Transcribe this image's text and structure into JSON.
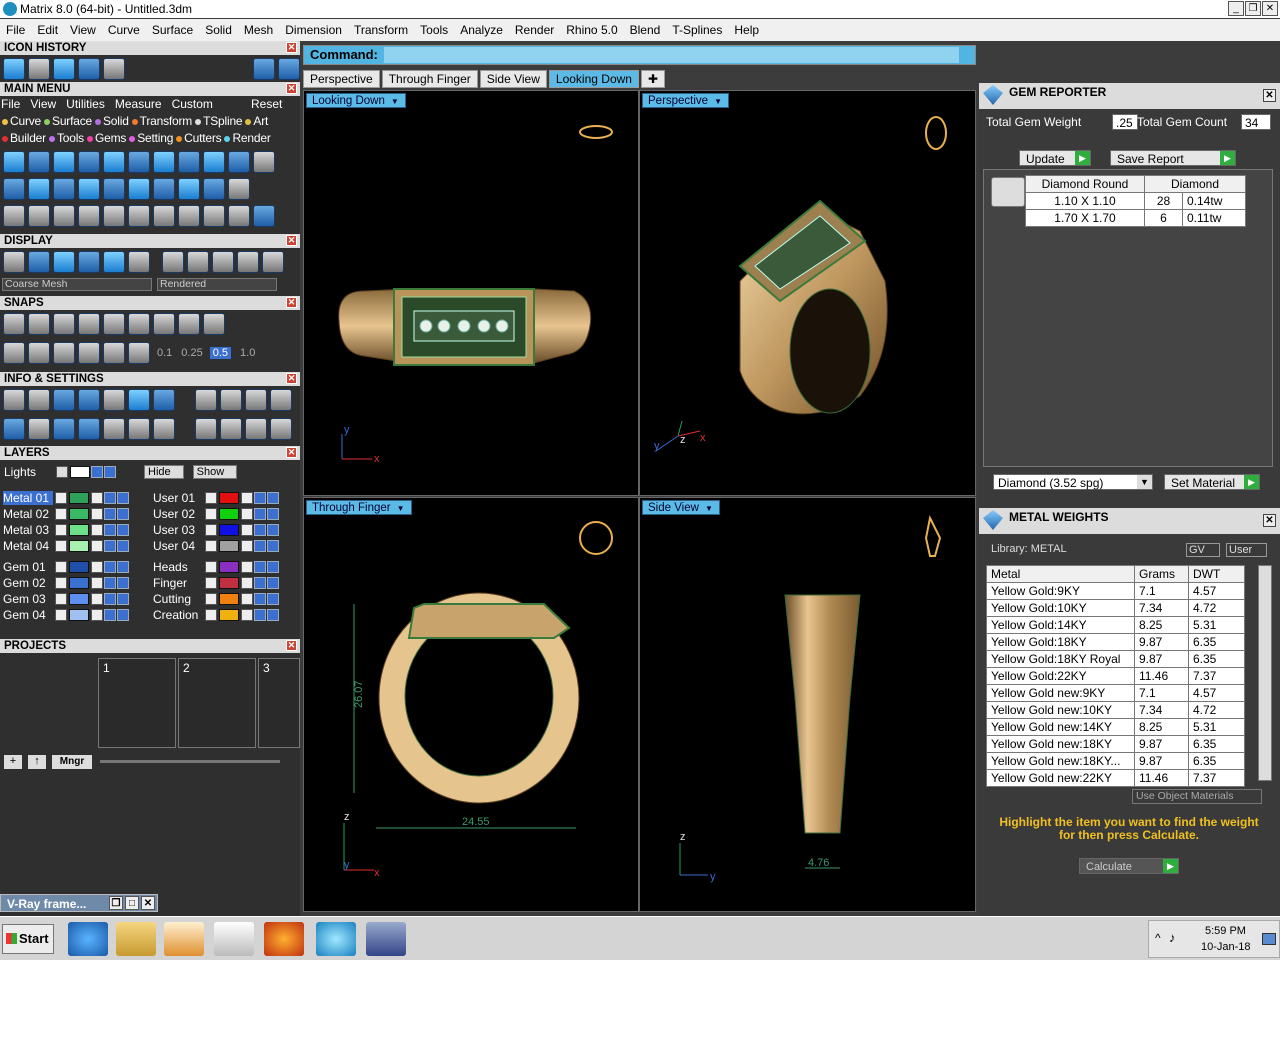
{
  "window": {
    "title": "Matrix 8.0 (64-bit) - Untitled.3dm",
    "controls": [
      "_",
      "❐",
      "✕"
    ]
  },
  "menubar": [
    "File",
    "Edit",
    "View",
    "Curve",
    "Surface",
    "Solid",
    "Mesh",
    "Dimension",
    "Transform",
    "Tools",
    "Analyze",
    "Render",
    "Rhino 5.0",
    "Blend",
    "T-Splines",
    "Help"
  ],
  "left": {
    "icon_history": "ICON HISTORY",
    "main_menu": "MAIN MENU",
    "main_menu_items": [
      "File",
      "View",
      "Utilities",
      "Measure",
      "Custom"
    ],
    "reset": "Reset",
    "categories_row1": [
      {
        "label": "Curve",
        "color": "#f0c040"
      },
      {
        "label": "Surface",
        "color": "#8fd05a"
      },
      {
        "label": "Solid",
        "color": "#b070e0"
      },
      {
        "label": "Transform",
        "color": "#f07a30"
      },
      {
        "label": "TSpline",
        "color": "#e0e0e0"
      },
      {
        "label": "Art",
        "color": "#e0c040"
      }
    ],
    "categories_row2": [
      {
        "label": "Builder",
        "color": "#e03030"
      },
      {
        "label": "Tools",
        "color": "#c070f0"
      },
      {
        "label": "Gems",
        "color": "#f040a0"
      },
      {
        "label": "Setting",
        "color": "#e060e0"
      },
      {
        "label": "Cutters",
        "color": "#f09020"
      },
      {
        "label": "Render",
        "color": "#60d0f0"
      }
    ],
    "display": "DISPLAY",
    "display_mesh": "Coarse Mesh",
    "display_mode": "Rendered",
    "snaps": "SNAPS",
    "snap_values": [
      "0.1",
      "0.25",
      "0.5",
      "1.0"
    ],
    "info_settings": "INFO & SETTINGS",
    "layers": "LAYERS",
    "lights": "Lights",
    "hide": "Hide",
    "show": "Show",
    "layers_left": [
      {
        "name": "Metal 01",
        "color": "#2ea05a",
        "selected": true
      },
      {
        "name": "Metal 02",
        "color": "#3ab865"
      },
      {
        "name": "Metal 03",
        "color": "#6ee08a"
      },
      {
        "name": "Metal 04",
        "color": "#a8f0b0"
      },
      {
        "name": "Gem 01",
        "color": "#1f4fa8"
      },
      {
        "name": "Gem 02",
        "color": "#3a70d0"
      },
      {
        "name": "Gem 03",
        "color": "#5c8ff0"
      },
      {
        "name": "Gem 04",
        "color": "#9fc0f0"
      }
    ],
    "layers_right": [
      {
        "name": "User 01",
        "color": "#e01010"
      },
      {
        "name": "User 02",
        "color": "#10d010"
      },
      {
        "name": "User 03",
        "color": "#1010e0"
      },
      {
        "name": "User 04",
        "color": "#a0a0a0"
      },
      {
        "name": "Heads",
        "color": "#8a30c0"
      },
      {
        "name": "Finger",
        "color": "#c03040"
      },
      {
        "name": "Cutting",
        "color": "#f08010"
      },
      {
        "name": "Creation",
        "color": "#f0b010"
      }
    ],
    "projects": "PROJECTS",
    "project_slots": [
      "1",
      "2",
      "3"
    ],
    "mngr": "Mngr",
    "vray": "V-Ray frame..."
  },
  "command": {
    "label": "Command:"
  },
  "viewport_tabs": [
    "Perspective",
    "Through Finger",
    "Side View",
    "Looking Down"
  ],
  "active_tab": "Looking Down",
  "viewports": {
    "top_left": {
      "label": "Looking Down",
      "axis1": "y",
      "axis2": "x"
    },
    "top_right": {
      "label": "Perspective",
      "axis1": "y",
      "axis2": "z",
      "axis3": "x"
    },
    "bottom_left": {
      "label": "Through Finger",
      "axis1": "z",
      "axis2": "y",
      "axis3": "x",
      "dim_height": "26.07",
      "dim_width": "24.55"
    },
    "bottom_right": {
      "label": "Side View",
      "axis1": "z",
      "axis2": "y",
      "dim_width": "4.76"
    }
  },
  "gem_reporter": {
    "title": "GEM REPORTER",
    "total_weight_label": "Total Gem Weight",
    "total_weight": ".25",
    "total_count_label": "Total Gem Count",
    "total_count": "34",
    "update": "Update",
    "save_report": "Save Report",
    "headers": [
      "Diamond Round",
      "Diamond"
    ],
    "rows": [
      {
        "size": "1.10 X 1.10",
        "count": "28",
        "tw": "0.14tw"
      },
      {
        "size": "1.70 X 1.70",
        "count": "6",
        "tw": "0.11tw"
      }
    ],
    "material": "Diamond     (3.52 spg)",
    "set_material": "Set Material"
  },
  "metal_weights": {
    "title": "METAL WEIGHTS",
    "library": "Library: METAL",
    "gv": "GV",
    "user": "User",
    "headers": [
      "Metal",
      "Grams",
      "DWT"
    ],
    "rows": [
      [
        "Yellow Gold:9KY",
        "7.1",
        "4.57"
      ],
      [
        "Yellow Gold:10KY",
        "7.34",
        "4.72"
      ],
      [
        "Yellow Gold:14KY",
        "8.25",
        "5.31"
      ],
      [
        "Yellow Gold:18KY",
        "9.87",
        "6.35"
      ],
      [
        "Yellow Gold:18KY Royal",
        "9.87",
        "6.35"
      ],
      [
        "Yellow Gold:22KY",
        "11.46",
        "7.37"
      ],
      [
        "Yellow Gold new:9KY",
        "7.1",
        "4.57"
      ],
      [
        "Yellow Gold new:10KY",
        "7.34",
        "4.72"
      ],
      [
        "Yellow Gold new:14KY",
        "8.25",
        "5.31"
      ],
      [
        "Yellow Gold new:18KY",
        "9.87",
        "6.35"
      ],
      [
        "Yellow Gold new:18KY...",
        "9.87",
        "6.35"
      ],
      [
        "Yellow Gold new:22KY",
        "11.46",
        "7.37"
      ]
    ],
    "use_object_materials": "Use Object Materials",
    "hint": "Highlight the item you want to find the weight for then press Calculate.",
    "calculate": "Calculate"
  },
  "taskbar": {
    "start": "Start",
    "time": "5:59 PM",
    "date": "10-Jan-18"
  }
}
